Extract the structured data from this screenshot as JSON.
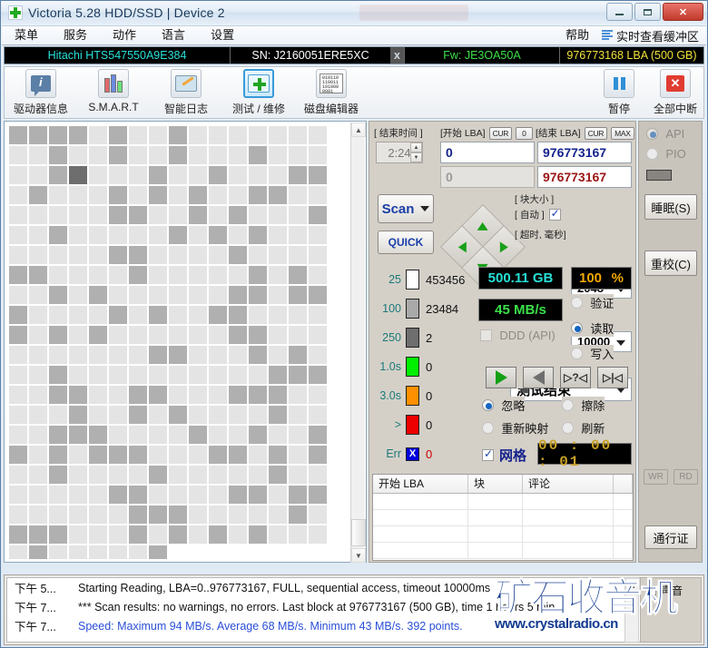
{
  "window": {
    "title": "Victoria 5.28 HDD/SSD | Device 2",
    "logo_icon": "green-cross-icon",
    "minimize_label": "–",
    "maximize_label": "□",
    "close_label": "✕"
  },
  "menu": {
    "items": [
      {
        "label": "菜单"
      },
      {
        "label": "服务"
      },
      {
        "label": "动作"
      },
      {
        "label": "语言"
      },
      {
        "label": "设置"
      }
    ],
    "help_label": "帮助",
    "buffer_label": "实时查看缓冲区",
    "buffer_icon": "list-lines-icon"
  },
  "drive_bar": {
    "model": "Hitachi HTS547550A9E384",
    "serial": "SN: J2160051ERE5XC",
    "x_label": "x",
    "firmware": "Fw: JE3OA50A",
    "capacity": "976773168 LBA (500 GB)",
    "model_color": "#27e0d8",
    "fw_color": "#3ce04a",
    "lba_color": "#f0e23a"
  },
  "toolbar": {
    "buttons": [
      {
        "label": "驱动器信息",
        "icon": "info-bubble-icon",
        "selected": false
      },
      {
        "label": "S.M.A.R.T",
        "icon": "test-tubes-icon",
        "selected": false
      },
      {
        "label": "智能日志",
        "icon": "folder-pencil-icon",
        "selected": false
      },
      {
        "label": "测试 / 维修",
        "icon": "first-aid-kit-icon",
        "selected": true
      },
      {
        "label": "磁盘编辑器",
        "icon": "hex-editor-icon",
        "selected": false
      }
    ],
    "hex_sample": "010110\n110011\n101000\n0001",
    "pause": {
      "label": "暂停",
      "icon": "pause-icon"
    },
    "abort": {
      "label": "全部中断",
      "icon": "red-x-icon"
    }
  },
  "scan": {
    "end_time_label": "[ 结束时间 ]",
    "end_time_value": "2:24",
    "start_lba_label": "[开始 LBA]",
    "start_cur_label": "CUR",
    "start_zero_label": "0",
    "end_lba_label": "[结束 LBA]",
    "end_cur_label": "CUR",
    "end_max_label": "MAX",
    "start_lba_value": "0",
    "end_lba_value": "976773167",
    "start_lba_readonly": "0",
    "end_lba_readonly": "976773167",
    "scan_button": "Scan",
    "quick_button": "QUICK",
    "block_size_label": "[ 块大小 ]",
    "auto_label": "[ 自动 ]",
    "auto_checked": true,
    "block_size_value": "2048",
    "timeout_label": "[ 超时, 毫秒]",
    "timeout_value": "10000",
    "on_finish_value": "测试结束"
  },
  "legend": {
    "rows": [
      {
        "threshold": "25",
        "color": "#ffffff",
        "count": "453456"
      },
      {
        "threshold": "100",
        "color": "#a9a9a9",
        "count": "23484"
      },
      {
        "threshold": "250",
        "color": "#6e6e6e",
        "count": "2"
      },
      {
        "threshold": "1.0s",
        "color": "#00ee00",
        "count": "0"
      },
      {
        "threshold": "3.0s",
        "color": "#ff9000",
        "count": "0"
      },
      {
        "threshold": ">",
        "color": "#ee0000",
        "count": "0"
      },
      {
        "threshold": "Err",
        "color": "#0000dd",
        "count": "0",
        "is_err": true,
        "err_mark": "X"
      }
    ]
  },
  "status": {
    "size_value": "500.11 GB",
    "size_color": "#27e0d8",
    "percent_value": "100",
    "percent_unit": "%",
    "percent_color": "#f0a800",
    "speed_value": "45 MB/s",
    "speed_color": "#3ce04a",
    "ddd_label": "DDD (API)",
    "ddd_checked": false,
    "modes": [
      {
        "label": "验证",
        "selected": false
      },
      {
        "label": "读取",
        "selected": true
      },
      {
        "label": "写入",
        "selected": false
      }
    ],
    "transport": [
      {
        "icon": "play-forward-icon"
      },
      {
        "icon": "play-reverse-icon"
      },
      {
        "icon": "random-seek-icon"
      },
      {
        "icon": "butterfly-seek-icon"
      }
    ],
    "actions": [
      {
        "label": "忽略",
        "selected": true
      },
      {
        "label": "擦除",
        "selected": false
      },
      {
        "label": "重新映射",
        "selected": false
      },
      {
        "label": "刷新",
        "selected": false
      }
    ],
    "grid_label": "网格",
    "grid_checked": true,
    "timer_value": "00 : 00 : 01"
  },
  "defects_table": {
    "columns": [
      "开始 LBA",
      "块",
      "评论",
      ""
    ],
    "rows": []
  },
  "rail": {
    "api_label": "API",
    "api_selected": true,
    "pio_label": "PIO",
    "pio_selected": false,
    "sleep_button": "睡眠(S)",
    "recal_button": "重校(C)",
    "wr_button": "WR",
    "rd_button": "RD",
    "pass_button": "通行证"
  },
  "log": {
    "entries": [
      {
        "time": "下午 5...",
        "message": "Starting Reading, LBA=0..976773167, FULL, sequential access, timeout 10000ms",
        "blue": false
      },
      {
        "time": "下午 7...",
        "message": "*** Scan results: no warnings, no errors. Last block at 976773167 (500 GB), time 1 hours 5 min",
        "blue": false
      },
      {
        "time": "下午 7...",
        "message": "Speed: Maximum 94 MB/s. Average 68 MB/s. Minimum 43 MB/s. 392 points.",
        "blue": true
      }
    ],
    "sound_label": "声音",
    "sound_checked": true
  },
  "watermark": {
    "text": "矿石收音机",
    "url": "www.crystalradio.cn"
  },
  "block_map": {
    "cols": 16,
    "rows": 22,
    "last_row_cells": 8,
    "color_light": "#e4e4e4",
    "color_mid": "#b0b0b0",
    "color_dark": "#6e6e6e",
    "pattern": "pseudo-random light/mid distribution, one dark cell near top-left"
  }
}
